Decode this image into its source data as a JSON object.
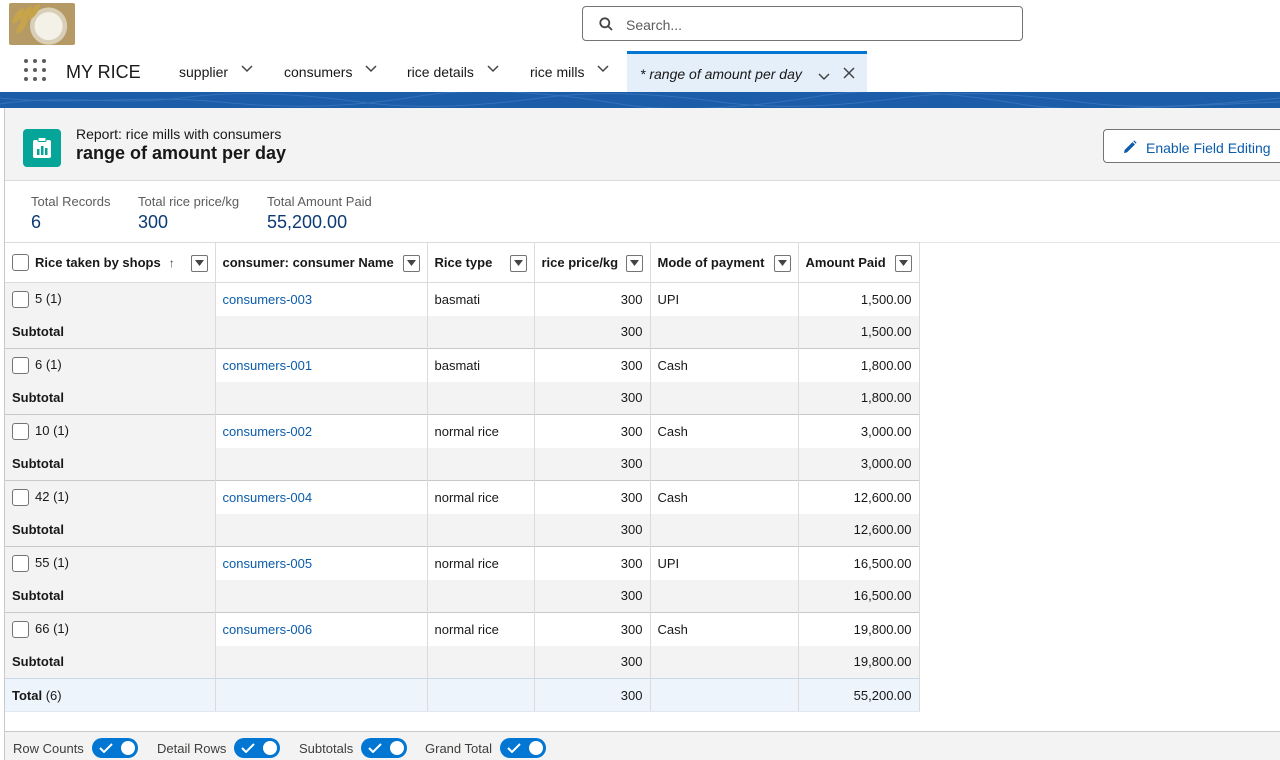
{
  "search": {
    "placeholder": "Search..."
  },
  "app": {
    "name": "MY RICE"
  },
  "nav": {
    "items": [
      {
        "label": "supplier"
      },
      {
        "label": "consumers"
      },
      {
        "label": "rice details"
      },
      {
        "label": "rice mills"
      }
    ],
    "active_tab": {
      "label": "* range of amount per day"
    }
  },
  "report": {
    "subtitle": "Report: rice mills with consumers",
    "title": "range of amount per day",
    "edit_button": "Enable Field Editing"
  },
  "aggregates": [
    {
      "label": "Total Records",
      "value": "6"
    },
    {
      "label": "Total rice price/kg",
      "value": "300"
    },
    {
      "label": "Total Amount Paid",
      "value": "55,200.00"
    }
  ],
  "table": {
    "columns": [
      "Rice taken by shops",
      "consumer: consumer Name",
      "Rice type",
      "rice price/kg",
      "Mode of payment",
      "Amount Paid"
    ],
    "sort_indicator": "↑",
    "subtotal_label": "Subtotal",
    "groups": [
      {
        "group": "5 (1)",
        "consumer": "consumers-003",
        "type": "basmati",
        "price": "300",
        "mode": "UPI",
        "amount": "1,500.00",
        "sub_price": "300",
        "sub_amount": "1,500.00"
      },
      {
        "group": "6 (1)",
        "consumer": "consumers-001",
        "type": "basmati",
        "price": "300",
        "mode": "Cash",
        "amount": "1,800.00",
        "sub_price": "300",
        "sub_amount": "1,800.00"
      },
      {
        "group": "10 (1)",
        "consumer": "consumers-002",
        "type": "normal rice",
        "price": "300",
        "mode": "Cash",
        "amount": "3,000.00",
        "sub_price": "300",
        "sub_amount": "3,000.00"
      },
      {
        "group": "42 (1)",
        "consumer": "consumers-004",
        "type": "normal rice",
        "price": "300",
        "mode": "Cash",
        "amount": "12,600.00",
        "sub_price": "300",
        "sub_amount": "12,600.00"
      },
      {
        "group": "55 (1)",
        "consumer": "consumers-005",
        "type": "normal rice",
        "price": "300",
        "mode": "UPI",
        "amount": "16,500.00",
        "sub_price": "300",
        "sub_amount": "16,500.00"
      },
      {
        "group": "66 (1)",
        "consumer": "consumers-006",
        "type": "normal rice",
        "price": "300",
        "mode": "Cash",
        "amount": "19,800.00",
        "sub_price": "300",
        "sub_amount": "19,800.00"
      }
    ],
    "total": {
      "label": "Total",
      "count": "(6)",
      "price": "300",
      "amount": "55,200.00"
    }
  },
  "footer": {
    "toggles": [
      {
        "label": "Row Counts",
        "on": true
      },
      {
        "label": "Detail Rows",
        "on": true
      },
      {
        "label": "Subtotals",
        "on": true
      },
      {
        "label": "Grand Total",
        "on": true
      }
    ]
  },
  "colors": {
    "brand": "#0176d3",
    "link": "#0b5cab",
    "report_icon": "#06a59a",
    "band": "#1b5da8"
  }
}
